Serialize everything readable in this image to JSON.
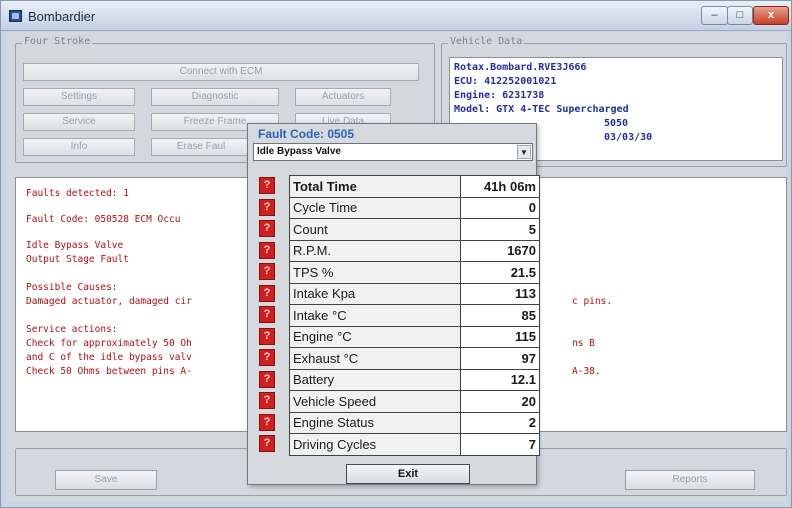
{
  "window": {
    "title": "Bombardier",
    "controls": {
      "close": "x"
    }
  },
  "four_stroke": {
    "label": "Four Stroke",
    "connect": "Connect with ECM",
    "settings": "Settings",
    "diagnostic": "Diagnostic",
    "actuators": "Actuators",
    "service": "Service",
    "freeze_frame": "Freeze Frame",
    "live_data": "Live Data",
    "info": "Info",
    "erase_faults": "Erase Faul"
  },
  "vehicle_data": {
    "label": "Vehicle Data",
    "lines": [
      "Rotax.Bombard.RVE3J666",
      "ECU: 412252001021",
      "Engine: 6231738",
      "Model: GTX 4-TEC Supercharged",
      "5050",
      "03/03/30"
    ]
  },
  "fault_text": {
    "detected": "Faults detected: 1",
    "code_line": "Fault Code: 050528  ECM  Occu",
    "desc1": "Idle Bypass Valve",
    "desc2": "Output Stage Fault",
    "causes_title": "Possible Causes:",
    "causes1": "Damaged actuator, damaged cir",
    "causes1_tail": "c pins.",
    "actions_title": "Service actions:",
    "act1": "Check for approximately 50 Oh",
    "act1_tail": "ns B",
    "act2": "and C of the idle bypass valv",
    "act3": "Check 50 Ohms between pins A-",
    "act3_tail": "A-38."
  },
  "bottom": {
    "save": "Save",
    "reports": "Reports"
  },
  "dialog": {
    "title": "Fault Code: 0505",
    "selected": "Idle Bypass Valve",
    "exit": "Exit",
    "icon_glyph": "?",
    "params": [
      {
        "name": "Total Time",
        "value": "41h 06m"
      },
      {
        "name": "Cycle Time",
        "value": "0"
      },
      {
        "name": "Count",
        "value": "5"
      },
      {
        "name": "R.P.M.",
        "value": "1670"
      },
      {
        "name": "TPS %",
        "value": "21.5"
      },
      {
        "name": "Intake Kpa",
        "value": "113"
      },
      {
        "name": "Intake °C",
        "value": "85"
      },
      {
        "name": "Engine °C",
        "value": "115"
      },
      {
        "name": "Exhaust °C",
        "value": "97"
      },
      {
        "name": "Battery",
        "value": "12.1"
      },
      {
        "name": "Vehicle Speed",
        "value": "20"
      },
      {
        "name": "Engine Status",
        "value": "2"
      },
      {
        "name": "Driving Cycles",
        "value": "7"
      }
    ]
  },
  "colors": {
    "fault_text": "#b01010",
    "vehicle_text": "#1f2fa0",
    "icon_red": "#cf1f1f",
    "dialog_title": "#2d63b8"
  }
}
